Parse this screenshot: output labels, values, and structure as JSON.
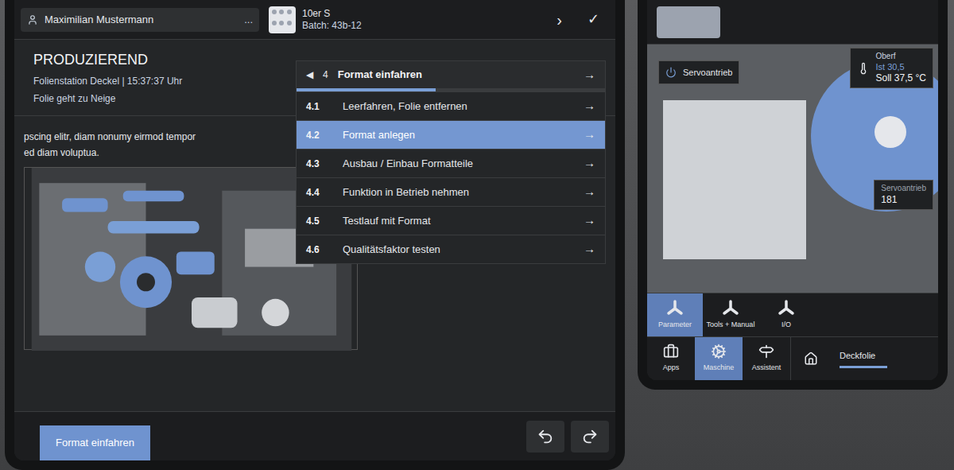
{
  "left_panel": {
    "user": {
      "name": "Maximilian Mustermann",
      "menu": "..."
    },
    "batch": {
      "product": "10er S",
      "batch": "Batch: 43b-12",
      "next": "›",
      "confirm": "✓"
    },
    "status": {
      "state": "PRODUZIEREND",
      "source": "Folienstation Deckel | 15:37:37 Uhr",
      "message": "Folie geht zu Neige"
    },
    "description": [
      "pscing elitr, diam nonumy eirmod tempor",
      "ed diam voluptua."
    ],
    "steps": {
      "back": "◀",
      "number": "4",
      "title": "Format einfahren",
      "arrow": "→",
      "level": 0.45,
      "items": [
        {
          "number": "4.1",
          "label": "Leerfahren, Folie entfernen",
          "arrow": "→",
          "selected": false
        },
        {
          "number": "4.2",
          "label": "Format anlegen",
          "arrow": "→",
          "selected": true
        },
        {
          "number": "4.3",
          "label": "Ausbau / Einbau Formatteile",
          "arrow": "→",
          "selected": false
        },
        {
          "number": "4.4",
          "label": "Funktion in Betrieb nehmen",
          "arrow": "→",
          "selected": false
        },
        {
          "number": "4.5",
          "label": "Testlauf mit Format",
          "arrow": "→",
          "selected": false
        },
        {
          "number": "4.6",
          "label": "Qualitätsfaktor testen",
          "arrow": "→",
          "selected": false
        }
      ]
    },
    "bottom_tab": {
      "label": "Format einfahren",
      "selected": true
    }
  },
  "right_panel": {
    "servo_button": {
      "label": "Servoantrieb",
      "on": true
    },
    "temperature": {
      "title": "Oberf",
      "actual": "Ist 30,5",
      "target": "Soll 37,5 °C"
    },
    "servo_reading": {
      "label": "Servoantrieb",
      "value": "181"
    },
    "nav_top": [
      {
        "label": "Parameter",
        "selected": true
      },
      {
        "label": "Tools + Manual",
        "selected": false
      },
      {
        "label": "I/O",
        "selected": false
      }
    ],
    "nav_bottom": [
      {
        "label": "Apps",
        "kind": "apps",
        "selected": false
      },
      {
        "label": "Maschine",
        "kind": "machine",
        "selected": true
      },
      {
        "label": "Assistent",
        "kind": "assistant",
        "selected": false
      }
    ],
    "section": {
      "label": "Deckfolie",
      "selected": true
    }
  }
}
